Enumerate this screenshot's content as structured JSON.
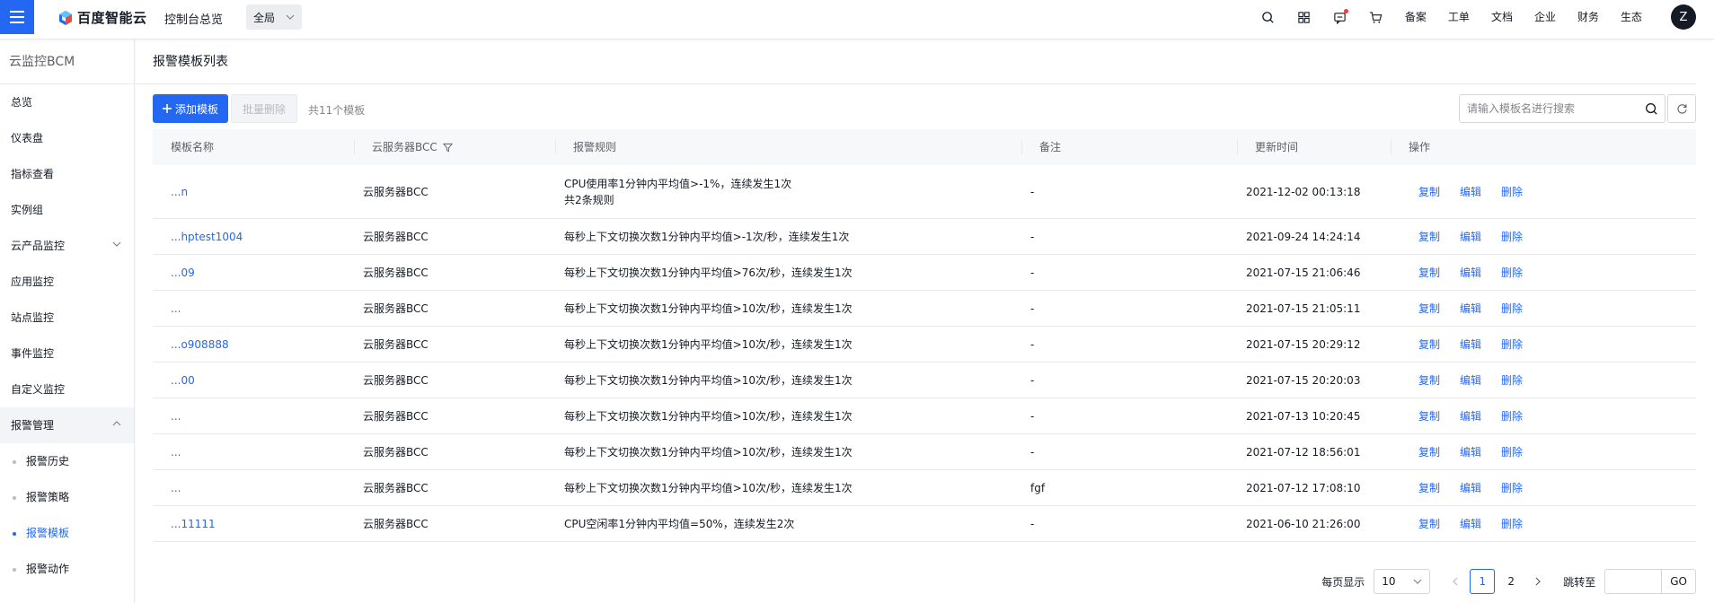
{
  "topbar": {
    "brand": "百度智能云",
    "console_title": "控制台总览",
    "region": "全局",
    "nav_links": [
      "备案",
      "工单",
      "文档",
      "企业",
      "财务",
      "生态"
    ],
    "avatar_letter": "Z",
    "accent_color": "#2468f2"
  },
  "sidebar": {
    "title": "云监控BCM",
    "items": [
      {
        "label": "总览"
      },
      {
        "label": "仪表盘"
      },
      {
        "label": "指标查看"
      },
      {
        "label": "实例组"
      },
      {
        "label": "云产品监控"
      },
      {
        "label": "应用监控"
      },
      {
        "label": "站点监控"
      },
      {
        "label": "事件监控"
      },
      {
        "label": "自定义监控"
      },
      {
        "label": "报警管理"
      }
    ],
    "sub_items": [
      {
        "label": "报警历史"
      },
      {
        "label": "报警策略"
      },
      {
        "label": "报警模板",
        "active": true
      },
      {
        "label": "报警动作"
      }
    ]
  },
  "main": {
    "page_title": "报警模板列表",
    "add_button": "添加模板",
    "batch_delete_button": "批量删除",
    "count_text": "共11个模板",
    "search_placeholder": "请输入模板名进行搜索",
    "columns": [
      "模板名称",
      "云服务器BCC",
      "报警规则",
      "备注",
      "更新时间",
      "操作"
    ],
    "rows": [
      {
        "name": "...n",
        "product": "云服务器BCC",
        "rule": "CPU使用率1分钟内平均值>-1%，连续发生1次",
        "rule2": "共2条规则",
        "note": "-",
        "updated": "2021-12-02 00:13:18"
      },
      {
        "name": "...hptest1004",
        "product": "云服务器BCC",
        "rule": "每秒上下文切换次数1分钟内平均值>-1次/秒，连续发生1次",
        "rule2": "",
        "note": "-",
        "updated": "2021-09-24 14:24:14"
      },
      {
        "name": "...09",
        "product": "云服务器BCC",
        "rule": "每秒上下文切换次数1分钟内平均值>76次/秒，连续发生1次",
        "rule2": "",
        "note": "-",
        "updated": "2021-07-15 21:06:46"
      },
      {
        "name": "...",
        "product": "云服务器BCC",
        "rule": "每秒上下文切换次数1分钟内平均值>10次/秒，连续发生1次",
        "rule2": "",
        "note": "-",
        "updated": "2021-07-15 21:05:11"
      },
      {
        "name": "...o908888",
        "product": "云服务器BCC",
        "rule": "每秒上下文切换次数1分钟内平均值>10次/秒，连续发生1次",
        "rule2": "",
        "note": "-",
        "updated": "2021-07-15 20:29:12"
      },
      {
        "name": "...00",
        "product": "云服务器BCC",
        "rule": "每秒上下文切换次数1分钟内平均值>10次/秒，连续发生1次",
        "rule2": "",
        "note": "-",
        "updated": "2021-07-15 20:20:03"
      },
      {
        "name": "...",
        "product": "云服务器BCC",
        "rule": "每秒上下文切换次数1分钟内平均值>10次/秒，连续发生1次",
        "rule2": "",
        "note": "-",
        "updated": "2021-07-13 10:20:45"
      },
      {
        "name": "...",
        "product": "云服务器BCC",
        "rule": "每秒上下文切换次数1分钟内平均值>10次/秒，连续发生1次",
        "rule2": "",
        "note": "-",
        "updated": "2021-07-12 18:56:01"
      },
      {
        "name": "...",
        "product": "云服务器BCC",
        "rule": "每秒上下文切换次数1分钟内平均值>10次/秒，连续发生1次",
        "rule2": "",
        "note": "fgf",
        "updated": "2021-07-12 17:08:10"
      },
      {
        "name": "...11111",
        "product": "云服务器BCC",
        "rule": "CPU空闲率1分钟内平均值=50%，连续发生2次",
        "rule2": "",
        "note": "-",
        "updated": "2021-06-10 21:26:00"
      }
    ],
    "row_actions": [
      "复制",
      "编辑",
      "删除"
    ]
  },
  "pager": {
    "per_page_label": "每页显示",
    "per_page_value": "10",
    "pages": [
      "1",
      "2"
    ],
    "current_page": "1",
    "jump_label": "跳转至",
    "go_label": "GO"
  }
}
